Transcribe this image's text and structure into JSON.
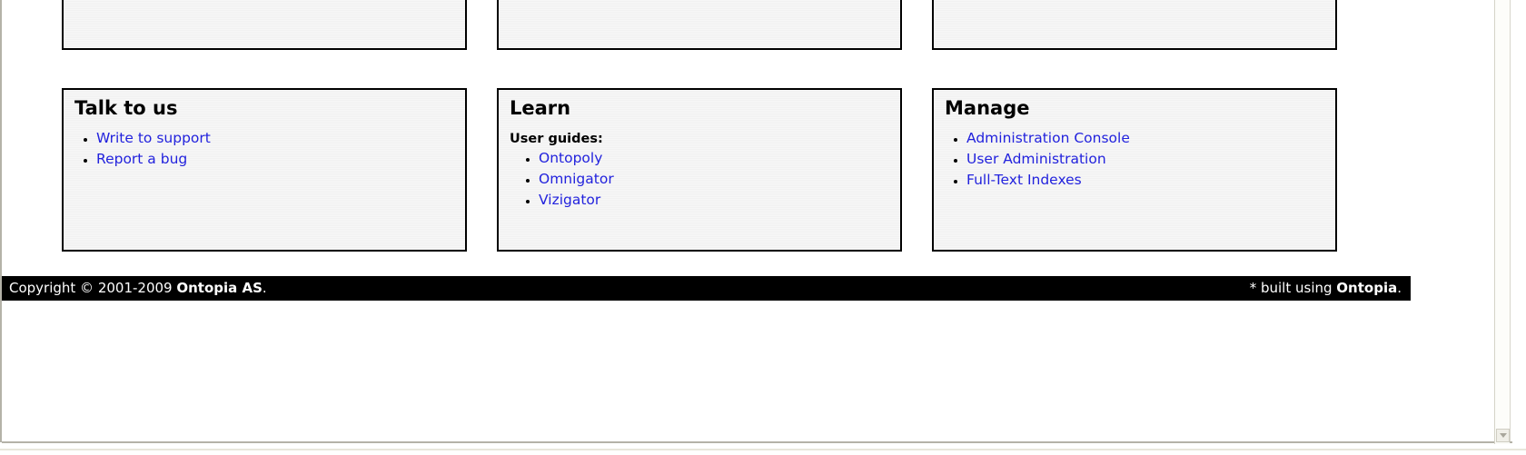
{
  "page": {
    "columns": [
      {
        "top_panel": {
          "title": "",
          "items": []
        },
        "panel": {
          "heading": "Talk to us",
          "sublabel": "",
          "links": [
            {
              "label": "Write to support"
            },
            {
              "label": "Report a bug"
            }
          ]
        }
      },
      {
        "top_panel": {
          "title": "",
          "items": []
        },
        "panel": {
          "heading": "Learn",
          "sublabel": "User guides:",
          "links": [
            {
              "label": "Ontopoly"
            },
            {
              "label": "Omnigator"
            },
            {
              "label": "Vizigator"
            }
          ]
        }
      },
      {
        "top_panel": {
          "title": "",
          "items": []
        },
        "panel": {
          "heading": "Manage",
          "sublabel": "",
          "links": [
            {
              "label": "Administration Console"
            },
            {
              "label": "User Administration"
            },
            {
              "label": "Full-Text Indexes"
            }
          ]
        }
      }
    ]
  },
  "footer": {
    "copyright_prefix": "Copyright © 2001-2009 ",
    "copyright_company": "Ontopia AS",
    "copyright_suffix": ".",
    "built_prefix": "* built using ",
    "built_company": "Ontopia",
    "built_suffix": "."
  },
  "scrollbar": {
    "down_arrow_icon": "chevron-down-icon"
  },
  "colors": {
    "link": "#2222dd",
    "panel_border": "#000000",
    "panel_background": "#f6f6f6",
    "footer_background": "#000000",
    "footer_text": "#ffffff"
  }
}
